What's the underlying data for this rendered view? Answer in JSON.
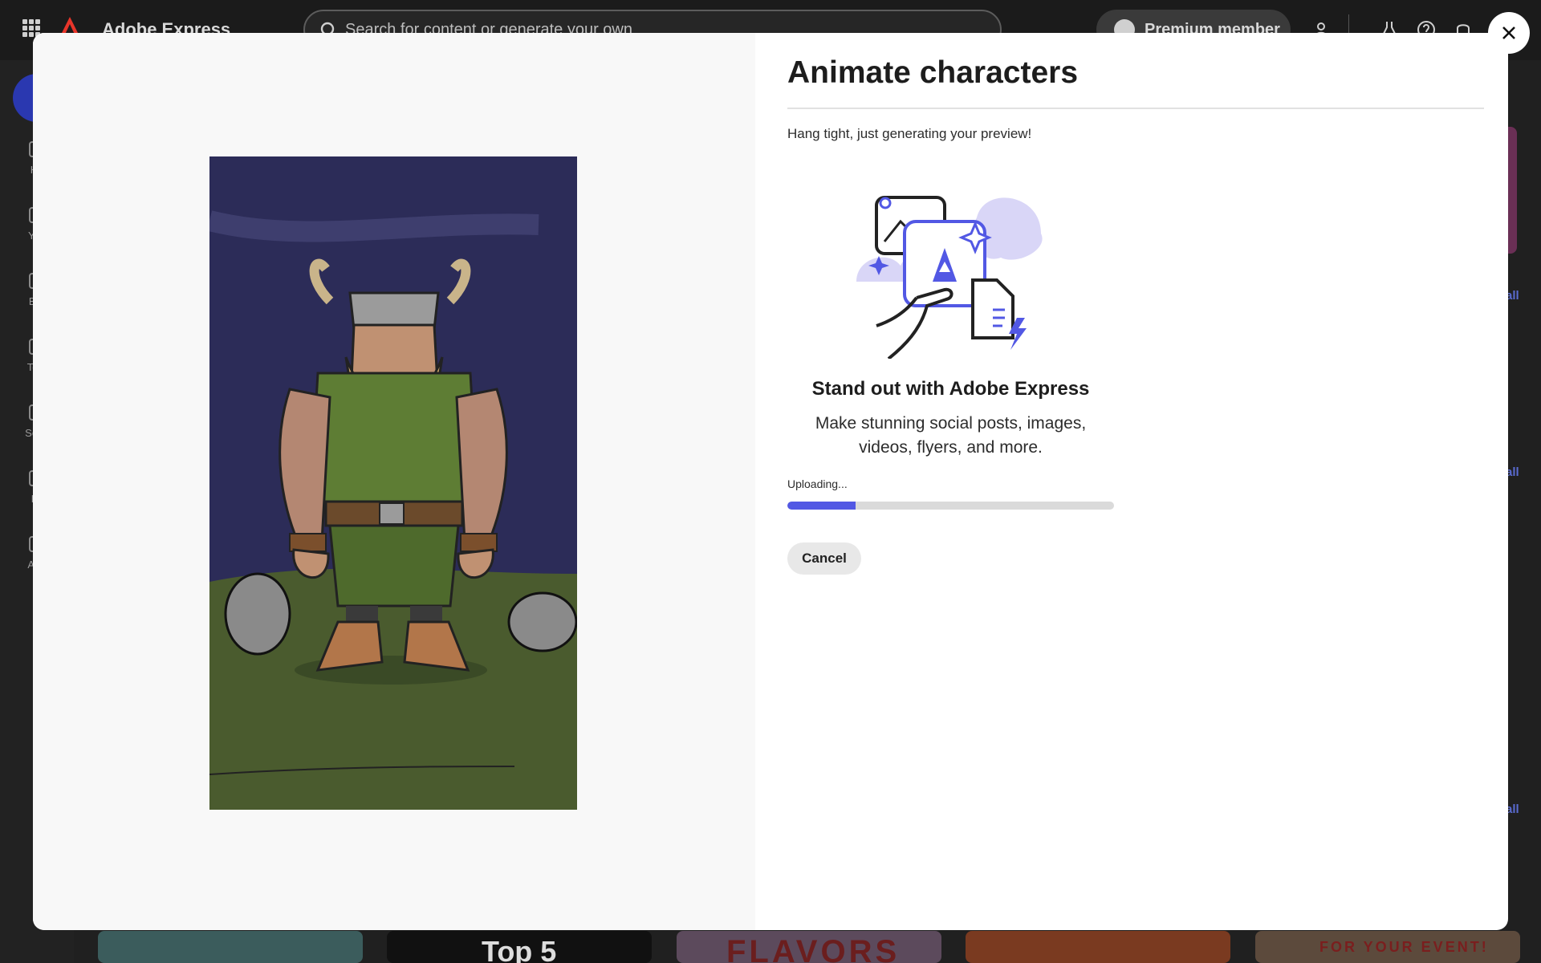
{
  "app": {
    "name": "Adobe Express",
    "search_placeholder": "Search for content or generate your own",
    "premium_label": "Premium member"
  },
  "sidebar": {
    "items": [
      {
        "label": "Ho",
        "icon": "home-icon"
      },
      {
        "label": "You",
        "icon": "your-stuff-icon"
      },
      {
        "label": "Bra",
        "icon": "brands-icon"
      },
      {
        "label": "Tem",
        "icon": "templates-icon"
      },
      {
        "label": "Sche",
        "icon": "schedule-icon"
      },
      {
        "label": "Le",
        "icon": "learn-icon"
      },
      {
        "label": "Add",
        "icon": "add-ons-icon"
      }
    ]
  },
  "background": {
    "see_all": [
      "all",
      "all",
      "all"
    ],
    "card_texts": [
      "Top 5",
      "FLAVORS",
      "FOR YOUR EVENT!"
    ]
  },
  "modal": {
    "title": "Animate characters",
    "status": "Hang tight, just generating your preview!",
    "promo_title": "Stand out with Adobe Express",
    "promo_body": "Make stunning social posts, images, videos, flyers, and more.",
    "progress_label": "Uploading...",
    "progress_value": 0.21,
    "cancel_label": "Cancel",
    "accent_color": "#5258e4"
  }
}
